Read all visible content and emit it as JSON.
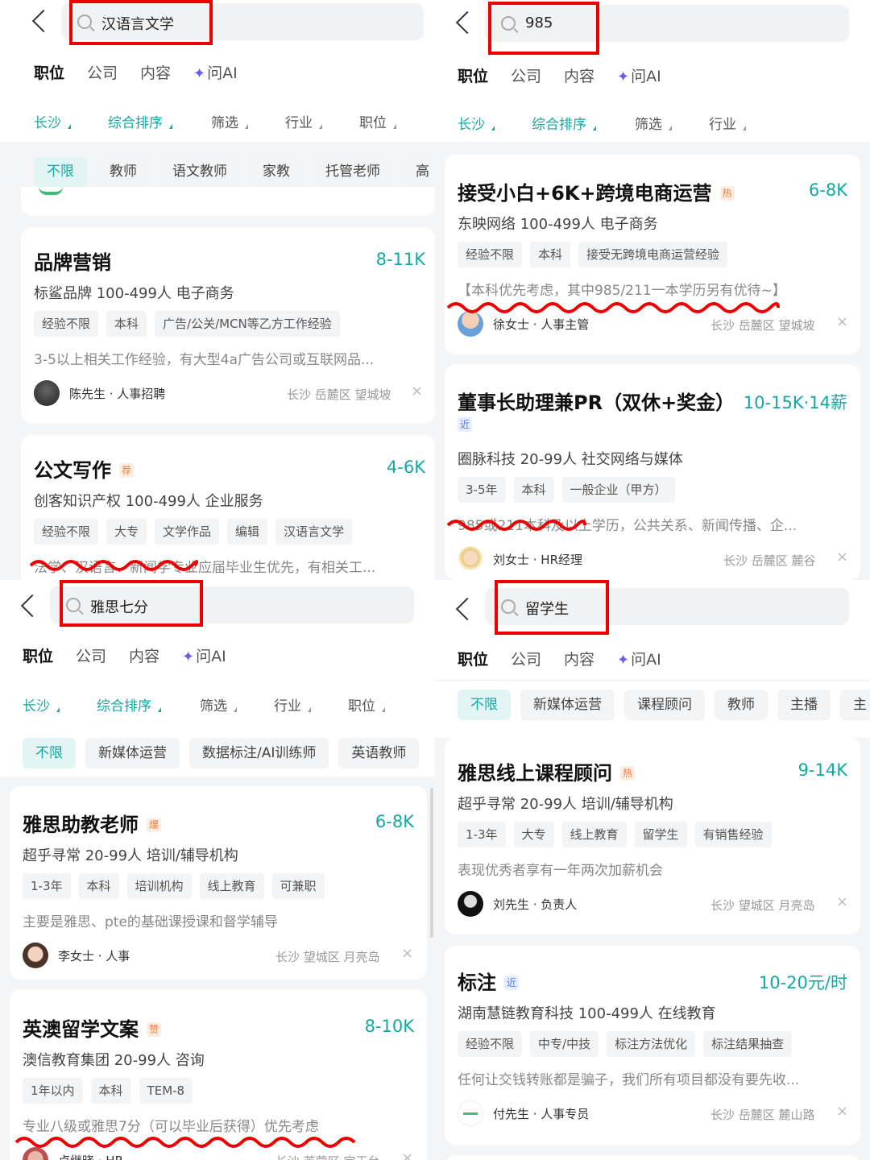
{
  "tabs": [
    "职位",
    "公司",
    "内容",
    "问AI"
  ],
  "panels": [
    {
      "search": "汉语言文学",
      "filters": [
        "长沙",
        "综合排序",
        "筛选",
        "行业",
        "职位"
      ],
      "chips": [
        "不限",
        "教师",
        "语文教师",
        "家教",
        "托管老师",
        "高"
      ],
      "jobs": [
        {
          "title": "品牌营销",
          "badge": "",
          "salary": "8-11K",
          "company": "标鲨品牌 100-499人 电子商务",
          "tags": [
            "经验不限",
            "本科",
            "广告/公关/MCN等乙方工作经验"
          ],
          "desc": "3-5以上相关工作经验，有大型4a广告公司或互联网品...",
          "hr": "陈先生 · 人事招聘",
          "loc": "长沙 岳麓区 望城坡"
        },
        {
          "title": "公文写作",
          "badge": "荐",
          "salary": "4-6K",
          "company": "创客知识产权 100-499人 企业服务",
          "tags": [
            "经验不限",
            "大专",
            "文学作品",
            "编辑",
            "汉语言文学"
          ],
          "desc": "法学、汉语言、新闻学专业应届毕业生优先，有相关工...",
          "hr": "",
          "loc": ""
        }
      ]
    },
    {
      "search": "985",
      "filters": [
        "长沙",
        "综合排序",
        "筛选",
        "行业"
      ],
      "chips": [],
      "jobs": [
        {
          "title": "接受小白+6K+跨境电商运营",
          "badge": "热",
          "salary": "6-8K",
          "company": "东映网络 100-499人 电子商务",
          "tags": [
            "经验不限",
            "本科",
            "接受无跨境电商运营经验"
          ],
          "desc": "【本科优先考虑，其中985/211一本学历另有优待~】",
          "hr": "徐女士 · 人事主管",
          "loc": "长沙 岳麓区 望城坡"
        },
        {
          "title": "董事长助理兼PR（双休+奖金）",
          "badge": "近",
          "salary": "10-15K·14薪",
          "company": "圈脉科技 20-99人 社交网络与媒体",
          "tags": [
            "3-5年",
            "本科",
            "一般企业（甲方）"
          ],
          "desc": "985或211本科及以上学历，公共关系、新闻传播、企...",
          "hr": "刘女士 · HR经理",
          "loc": "长沙 岳麓区 麓谷"
        }
      ]
    },
    {
      "search": "雅思七分",
      "filters": [
        "长沙",
        "综合排序",
        "筛选",
        "行业",
        "职位"
      ],
      "chips": [
        "不限",
        "新媒体运营",
        "数据标注/AI训练师",
        "英语教师"
      ],
      "jobs": [
        {
          "title": "雅思助教老师",
          "badge": "爆",
          "salary": "6-8K",
          "company": "超乎寻常 20-99人 培训/辅导机构",
          "tags": [
            "1-3年",
            "本科",
            "培训机构",
            "线上教育",
            "可兼职"
          ],
          "desc": "主要是雅思、pte的基础课授课和督学辅导",
          "hr": "李女士 · 人事",
          "loc": "长沙 望城区 月亮岛"
        },
        {
          "title": "英澳留学文案",
          "badge": "赞",
          "salary": "8-10K",
          "company": "澳信教育集团 20-99人 咨询",
          "tags": [
            "1年以内",
            "本科",
            "TEM-8"
          ],
          "desc": "专业八级或雅思7分（可以毕业后获得）优先考虑",
          "hr": "卢继晓 · HR",
          "loc": "长沙 芙蓉区 定王台"
        }
      ]
    },
    {
      "search": "留学生",
      "filters": [],
      "chips": [
        "不限",
        "新媒体运营",
        "课程顾问",
        "教师",
        "主播",
        "主"
      ],
      "jobs": [
        {
          "title": "雅思线上课程顾问",
          "badge": "热",
          "salary": "9-14K",
          "company": "超乎寻常 20-99人 培训/辅导机构",
          "tags": [
            "1-3年",
            "大专",
            "线上教育",
            "留学生",
            "有销售经验"
          ],
          "desc": "表现优秀者享有一年两次加薪机会",
          "hr": "刘先生 · 负责人",
          "loc": "长沙 望城区 月亮岛"
        },
        {
          "title": "标注",
          "badge": "近",
          "salary": "10-20元/时",
          "company": "湖南慧链教育科技 100-499人 在线教育",
          "tags": [
            "经验不限",
            "中专/中技",
            "标注方法优化",
            "标注结果抽查"
          ],
          "desc": "任何让交钱转账都是骗子，我们所有项目都没有要先收...",
          "hr": "付先生 · 人事专员",
          "loc": "长沙 岳麓区 麓山路"
        }
      ]
    }
  ],
  "close_symbol": "×",
  "colors": {
    "accent": "#12a9a2",
    "ai": "#6a5cf0",
    "highlight": "#e00000"
  }
}
